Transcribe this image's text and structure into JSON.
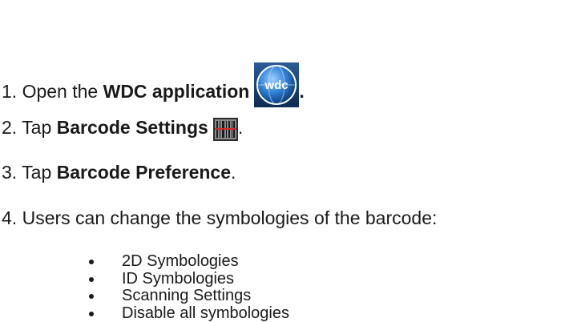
{
  "steps": [
    {
      "number": "1.",
      "pre": "Open the",
      "bold": "WDC application",
      "post": ".",
      "icon": "wdc-globe-icon",
      "icon_text": "wdc"
    },
    {
      "number": "2.",
      "pre": "Tap",
      "bold": "Barcode Settings",
      "post": ".",
      "icon": "barcode-settings-icon"
    },
    {
      "number": "3.",
      "pre": "Tap",
      "bold": "Barcode Preference",
      "post": "."
    },
    {
      "number": "4.",
      "text": "Users can change the symbologies of the barcode:"
    }
  ],
  "bullets": [
    "2D Symbologies",
    "ID Symbologies",
    "Scanning Settings",
    "Disable all symbologies"
  ],
  "colors": {
    "text": "#1a1a1a",
    "wdc_icon_blue": "#2f7fd3",
    "barcode_icon_red": "#d22a2a"
  }
}
